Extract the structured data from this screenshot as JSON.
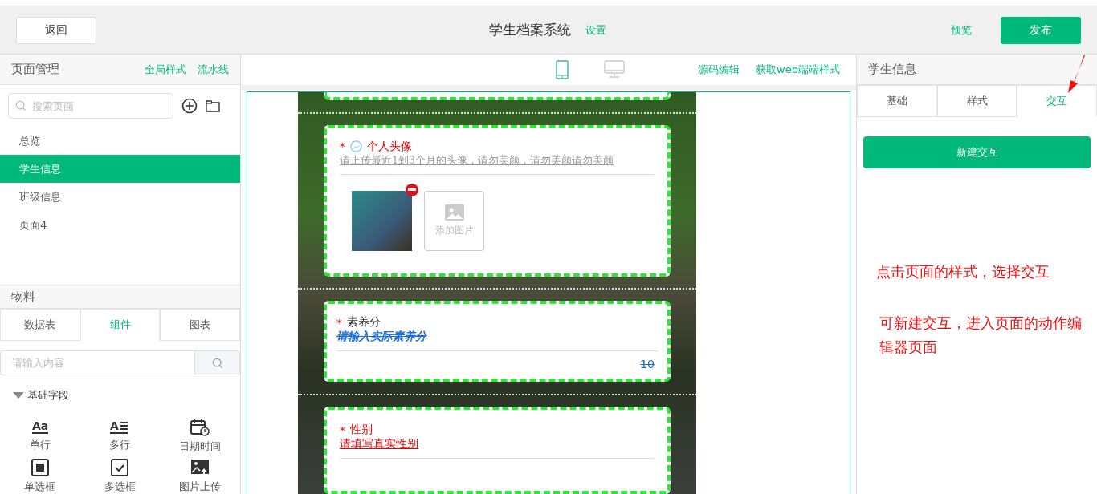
{
  "header": {
    "back": "返回",
    "title": "学生档案系统",
    "settings": "设置",
    "preview": "预览",
    "publish": "发布"
  },
  "pages_panel": {
    "title": "页面管理",
    "links": [
      "全局样式",
      "流水线"
    ],
    "search": {
      "placeholder": "搜索页面"
    },
    "items": [
      {
        "label": "总览",
        "selected": false
      },
      {
        "label": "学生信息",
        "selected": true
      },
      {
        "label": "班级信息",
        "selected": false
      },
      {
        "label": "页面4",
        "selected": false
      }
    ]
  },
  "materials_panel": {
    "title": "物料",
    "tabs": [
      {
        "label": "数据表",
        "selected": false
      },
      {
        "label": "组件",
        "selected": true
      },
      {
        "label": "图表",
        "selected": false
      }
    ],
    "search": {
      "placeholder": "请输入内容"
    },
    "section": {
      "label": "基础字段",
      "expanded": true
    },
    "components": [
      {
        "kind": "single-line",
        "label": "单行",
        "glyph": "Aa"
      },
      {
        "kind": "multi-line",
        "label": "多行",
        "glyph": "A"
      },
      {
        "kind": "datetime",
        "label": "日期时间"
      },
      {
        "kind": "radio",
        "label": "单选框"
      },
      {
        "kind": "checkbox",
        "label": "多选框"
      },
      {
        "kind": "image-upload",
        "label": "图片上传"
      }
    ]
  },
  "canvas_toolbar": {
    "devices": [
      {
        "kind": "mobile",
        "selected": true
      },
      {
        "kind": "desktop",
        "selected": false
      }
    ],
    "links": [
      "源码编辑",
      "获取web端端样式"
    ]
  },
  "form_fields": [
    {
      "kind": "image",
      "required_mark": "*",
      "label": "个人头像",
      "hint": "请上传最近1到3个月的头像，请勿美颜，请勿美颜请勿美颜",
      "add_label": "添加图片"
    },
    {
      "kind": "number",
      "required_mark": "*",
      "label": "素养分",
      "hint": "请输入实际素养分",
      "value": "10"
    },
    {
      "kind": "select",
      "required_mark": "*",
      "label": "性别",
      "hint": "请填写真实性别"
    }
  ],
  "properties_panel": {
    "title": "学生信息",
    "tabs": [
      {
        "label": "基础",
        "selected": false
      },
      {
        "label": "样式",
        "selected": false
      },
      {
        "label": "交互",
        "selected": true
      }
    ],
    "button": "新建交互"
  },
  "annotations": [
    "点击页面的样式，选择交互",
    "可新建交互，进入页面的动作编辑器页面"
  ]
}
